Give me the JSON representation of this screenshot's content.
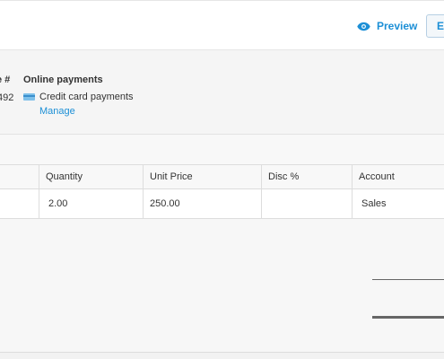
{
  "toolbar": {
    "preview_label": "Preview",
    "edit_button_label": "E",
    "preview_icon": "eye-icon"
  },
  "info": {
    "invoice_header": "e #",
    "invoice_value": "492",
    "online_payments_header": "Online payments",
    "credit_card_label": "Credit card payments",
    "credit_card_icon": "credit-card-icon",
    "manage_label": "Manage"
  },
  "table": {
    "columns": [
      "Quantity",
      "Unit Price",
      "Disc %",
      "Account"
    ],
    "rows": [
      {
        "quantity": "2.00",
        "unit_price": "250.00",
        "disc": "",
        "account": "Sales"
      }
    ]
  },
  "colors": {
    "link": "#1c8fd6",
    "panel_bg": "#f5f5f5",
    "border": "#dddddd"
  }
}
